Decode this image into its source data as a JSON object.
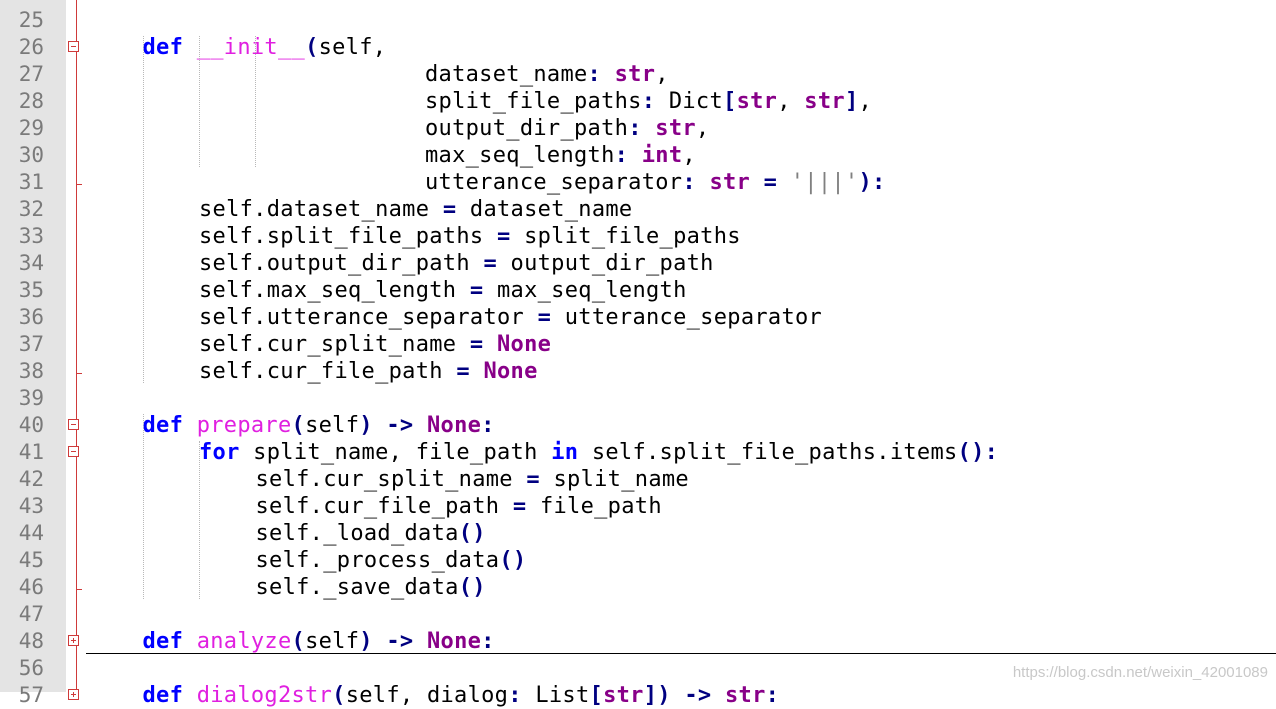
{
  "editor": {
    "lines": [
      {
        "num": "25",
        "text": ""
      },
      {
        "num": "26",
        "fold": "minus",
        "indent": 1,
        "tokens": [
          {
            "t": "def",
            "c": "kw"
          },
          {
            "t": " "
          },
          {
            "t": "__init__",
            "c": "fn"
          },
          {
            "t": "(",
            "c": "op"
          },
          {
            "t": "self,"
          }
        ]
      },
      {
        "num": "27",
        "indent": 6,
        "tokens": [
          {
            "t": "dataset_name"
          },
          {
            "t": ": ",
            "c": "op"
          },
          {
            "t": "str",
            "c": "kw2"
          },
          {
            "t": ","
          }
        ]
      },
      {
        "num": "28",
        "indent": 6,
        "tokens": [
          {
            "t": "split_file_paths"
          },
          {
            "t": ": ",
            "c": "op"
          },
          {
            "t": "Dict"
          },
          {
            "t": "[",
            "c": "op"
          },
          {
            "t": "str",
            "c": "kw2"
          },
          {
            "t": ", "
          },
          {
            "t": "str",
            "c": "kw2"
          },
          {
            "t": "]",
            "c": "op"
          },
          {
            "t": ","
          }
        ]
      },
      {
        "num": "29",
        "indent": 6,
        "tokens": [
          {
            "t": "output_dir_path"
          },
          {
            "t": ": ",
            "c": "op"
          },
          {
            "t": "str",
            "c": "kw2"
          },
          {
            "t": ","
          }
        ]
      },
      {
        "num": "30",
        "indent": 6,
        "tokens": [
          {
            "t": "max_seq_length"
          },
          {
            "t": ": ",
            "c": "op"
          },
          {
            "t": "int",
            "c": "kw2"
          },
          {
            "t": ","
          }
        ]
      },
      {
        "num": "31",
        "indent": 6,
        "foldEnd": true,
        "tokens": [
          {
            "t": "utterance_separator"
          },
          {
            "t": ": ",
            "c": "op"
          },
          {
            "t": "str",
            "c": "kw2"
          },
          {
            "t": " = ",
            "c": "op"
          },
          {
            "t": "'|||'",
            "c": "str"
          },
          {
            "t": "):",
            "c": "op"
          }
        ]
      },
      {
        "num": "32",
        "indent": 2,
        "tokens": [
          {
            "t": "self.dataset_name"
          },
          {
            "t": " = ",
            "c": "op"
          },
          {
            "t": "dataset_name"
          }
        ]
      },
      {
        "num": "33",
        "indent": 2,
        "tokens": [
          {
            "t": "self.split_file_paths"
          },
          {
            "t": " = ",
            "c": "op"
          },
          {
            "t": "split_file_paths"
          }
        ]
      },
      {
        "num": "34",
        "indent": 2,
        "tokens": [
          {
            "t": "self.output_dir_path"
          },
          {
            "t": " = ",
            "c": "op"
          },
          {
            "t": "output_dir_path"
          }
        ]
      },
      {
        "num": "35",
        "indent": 2,
        "tokens": [
          {
            "t": "self.max_seq_length"
          },
          {
            "t": " = ",
            "c": "op"
          },
          {
            "t": "max_seq_length"
          }
        ]
      },
      {
        "num": "36",
        "indent": 2,
        "tokens": [
          {
            "t": "self.utterance_separator"
          },
          {
            "t": " = ",
            "c": "op"
          },
          {
            "t": "utterance_separator"
          }
        ]
      },
      {
        "num": "37",
        "indent": 2,
        "tokens": [
          {
            "t": "self.cur_split_name"
          },
          {
            "t": " = ",
            "c": "op"
          },
          {
            "t": "None",
            "c": "kw2"
          }
        ]
      },
      {
        "num": "38",
        "indent": 2,
        "foldEnd": true,
        "tokens": [
          {
            "t": "self.cur_file_path"
          },
          {
            "t": " = ",
            "c": "op"
          },
          {
            "t": "None",
            "c": "kw2"
          }
        ]
      },
      {
        "num": "39",
        "text": ""
      },
      {
        "num": "40",
        "fold": "minus",
        "indent": 1,
        "tokens": [
          {
            "t": "def",
            "c": "kw"
          },
          {
            "t": " "
          },
          {
            "t": "prepare",
            "c": "fn"
          },
          {
            "t": "(",
            "c": "op"
          },
          {
            "t": "self"
          },
          {
            "t": ")",
            "c": "op"
          },
          {
            "t": " -> ",
            "c": "op"
          },
          {
            "t": "None",
            "c": "kw2"
          },
          {
            "t": ":",
            "c": "op"
          }
        ]
      },
      {
        "num": "41",
        "fold": "minus",
        "indent": 2,
        "tokens": [
          {
            "t": "for",
            "c": "kw"
          },
          {
            "t": " split_name, file_path "
          },
          {
            "t": "in",
            "c": "kw"
          },
          {
            "t": " self.split_file_paths.items"
          },
          {
            "t": "():",
            "c": "op"
          }
        ]
      },
      {
        "num": "42",
        "indent": 3,
        "tokens": [
          {
            "t": "self.cur_split_name"
          },
          {
            "t": " = ",
            "c": "op"
          },
          {
            "t": "split_name"
          }
        ]
      },
      {
        "num": "43",
        "indent": 3,
        "tokens": [
          {
            "t": "self.cur_file_path"
          },
          {
            "t": " = ",
            "c": "op"
          },
          {
            "t": "file_path"
          }
        ]
      },
      {
        "num": "44",
        "indent": 3,
        "tokens": [
          {
            "t": "self._load_data"
          },
          {
            "t": "()",
            "c": "op"
          }
        ]
      },
      {
        "num": "45",
        "indent": 3,
        "tokens": [
          {
            "t": "self._process_data"
          },
          {
            "t": "()",
            "c": "op"
          }
        ]
      },
      {
        "num": "46",
        "indent": 3,
        "foldEnd": true,
        "tokens": [
          {
            "t": "self._save_data"
          },
          {
            "t": "()",
            "c": "op"
          }
        ]
      },
      {
        "num": "47",
        "text": ""
      },
      {
        "num": "48",
        "fold": "plus",
        "indent": 1,
        "tokens": [
          {
            "t": "def",
            "c": "kw"
          },
          {
            "t": " "
          },
          {
            "t": "analyze",
            "c": "fn"
          },
          {
            "t": "(",
            "c": "op"
          },
          {
            "t": "self"
          },
          {
            "t": ")",
            "c": "op"
          },
          {
            "t": " -> ",
            "c": "op"
          },
          {
            "t": "None",
            "c": "kw2"
          },
          {
            "t": ":",
            "c": "op"
          }
        ]
      },
      {
        "num": "56",
        "text": ""
      },
      {
        "num": "57",
        "fold": "plus",
        "indent": 1,
        "tokens": [
          {
            "t": "def",
            "c": "kw"
          },
          {
            "t": " "
          },
          {
            "t": "dialog2str",
            "c": "fn"
          },
          {
            "t": "(",
            "c": "op"
          },
          {
            "t": "self, dialog"
          },
          {
            "t": ": ",
            "c": "op"
          },
          {
            "t": "List"
          },
          {
            "t": "[",
            "c": "op"
          },
          {
            "t": "str",
            "c": "kw2"
          },
          {
            "t": "]",
            "c": "op"
          },
          {
            "t": ")",
            "c": "op"
          },
          {
            "t": " -> ",
            "c": "op"
          },
          {
            "t": "str",
            "c": "kw2"
          },
          {
            "t": ":",
            "c": "op"
          }
        ]
      }
    ]
  },
  "watermark": "https://blog.csdn.net/weixin_42001089"
}
